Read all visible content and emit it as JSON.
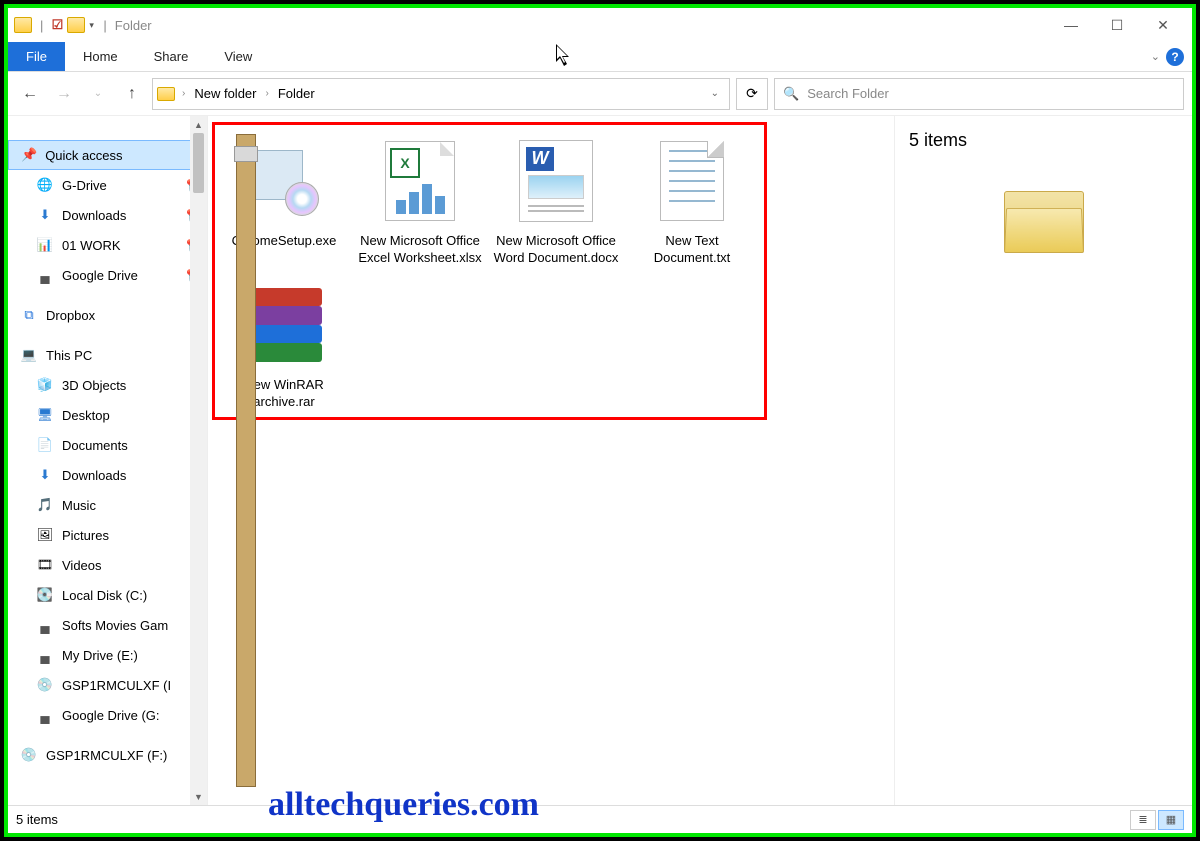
{
  "titlebar": {
    "window_title": "Folder"
  },
  "ribbon": {
    "file": "File",
    "tabs": [
      "Home",
      "Share",
      "View"
    ]
  },
  "breadcrumb": {
    "segments": [
      "New folder",
      "Folder"
    ]
  },
  "search": {
    "placeholder": "Search Folder"
  },
  "sidebar": {
    "quick_access": "Quick access",
    "qa_items": [
      {
        "label": "G-Drive",
        "icon": "🌐",
        "pinned": true
      },
      {
        "label": "Downloads",
        "icon": "⬇",
        "pinned": true
      },
      {
        "label": "01 WORK",
        "icon": "📊",
        "pinned": true
      },
      {
        "label": "Google Drive",
        "icon": "▄",
        "pinned": true
      }
    ],
    "dropbox": "Dropbox",
    "this_pc": "This PC",
    "pc_items": [
      {
        "label": "3D Objects",
        "icon": "🧊"
      },
      {
        "label": "Desktop",
        "icon": "🖥"
      },
      {
        "label": "Documents",
        "icon": "📄"
      },
      {
        "label": "Downloads",
        "icon": "⬇"
      },
      {
        "label": "Music",
        "icon": "🎵"
      },
      {
        "label": "Pictures",
        "icon": "🖼"
      },
      {
        "label": "Videos",
        "icon": "🎞"
      },
      {
        "label": "Local Disk (C:)",
        "icon": "💽"
      },
      {
        "label": "Softs Movies Gam",
        "icon": "▄"
      },
      {
        "label": "My Drive (E:)",
        "icon": "▄"
      },
      {
        "label": "GSP1RMCULXF (I",
        "icon": "💿"
      },
      {
        "label": "Google Drive (G:",
        "icon": "▄"
      }
    ],
    "extra": {
      "label": "GSP1RMCULXF (F:)",
      "icon": "💿"
    }
  },
  "files": [
    {
      "label": "ChromeSetup.exe",
      "type": "exe"
    },
    {
      "label": "New Microsoft Office Excel Worksheet.xlsx",
      "type": "excel"
    },
    {
      "label": "New Microsoft Office Word Document.docx",
      "type": "word"
    },
    {
      "label": "New Text Document.txt",
      "type": "txt"
    },
    {
      "label": "New WinRAR archive.rar",
      "type": "rar"
    }
  ],
  "preview": {
    "count_text": "5 items"
  },
  "statusbar": {
    "text": "5 items"
  },
  "watermark": "alltechqueries.com"
}
